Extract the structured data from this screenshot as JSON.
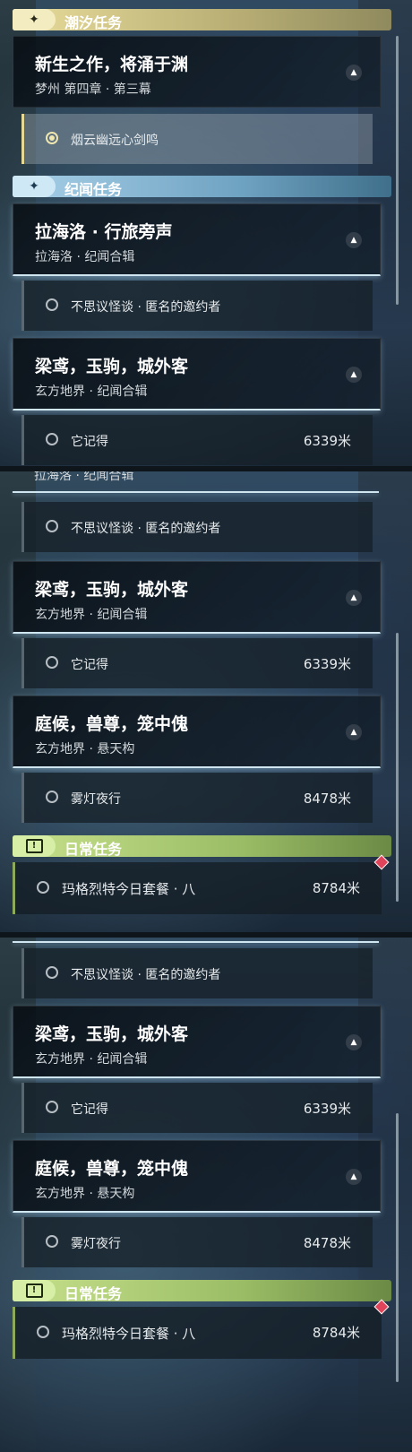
{
  "headers": {
    "tide": "潮汐任务",
    "legend": "纪闻任务",
    "daily": "日常任务"
  },
  "header_icons": {
    "tide": "sparkle-icon",
    "legend": "sparkle-icon",
    "daily": "exclamation-box-icon"
  },
  "tide_quest": {
    "title": "新生之作，将涌于渊",
    "subtitle": "梦州 第四章 · 第三幕"
  },
  "tide_sub": {
    "label": "烟云幽远心剑鸣"
  },
  "quest_lahailuo": {
    "title": "拉海洛 · 行旅旁声",
    "subtitle": "拉海洛 · 纪闻合辑"
  },
  "sub_buxiyi": {
    "label": "不思议怪谈 · 匿名的邀约者"
  },
  "quest_liangyuan": {
    "title": "梁鸢，玉驹，城外客",
    "subtitle": "玄方地界 · 纪闻合辑"
  },
  "sub_tajide": {
    "label": "它记得",
    "distance": "6339米"
  },
  "quest_tinghou": {
    "title": "庭候，兽尊，笼中傀",
    "subtitle": "玄方地界 · 悬天构"
  },
  "sub_wudeng": {
    "label": "雾灯夜行",
    "distance": "8478米"
  },
  "daily_item": {
    "label": "玛格烈特今日套餐 · 八",
    "distance": "8784米"
  },
  "collapse_glyph": "▲",
  "colors": {
    "tide_accent": "#e5d995",
    "legend_accent": "#a8d0e8",
    "daily_accent": "#c7e08b",
    "alert": "#e0445a"
  }
}
